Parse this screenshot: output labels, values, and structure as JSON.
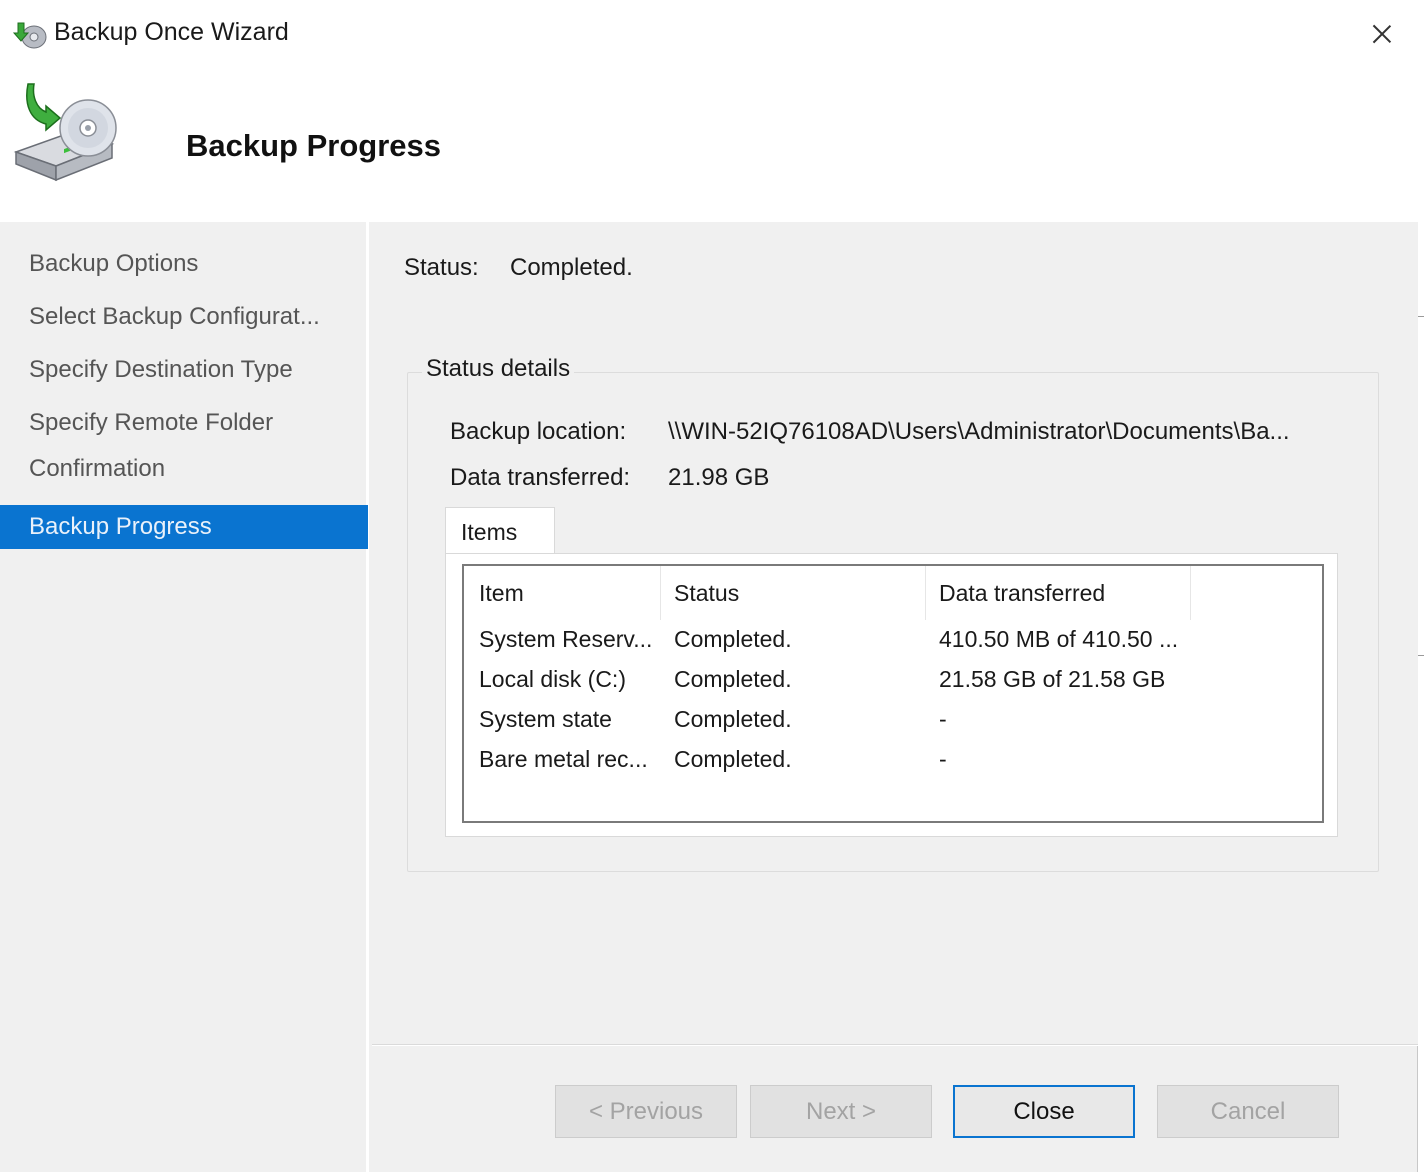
{
  "window": {
    "title": "Backup Once Wizard",
    "close_icon": "close-icon"
  },
  "header": {
    "title": "Backup Progress",
    "icon": "backup-disk-icon"
  },
  "nav": {
    "items": [
      {
        "label": "Backup Options",
        "active": false
      },
      {
        "label": "Select Backup Configurat...",
        "active": false
      },
      {
        "label": "Specify Destination Type",
        "active": false
      },
      {
        "label": "Specify Remote Folder",
        "active": false
      },
      {
        "label": "Confirmation",
        "active": false
      },
      {
        "label": "Backup Progress",
        "active": true
      }
    ]
  },
  "status": {
    "label": "Status:",
    "value": "Completed."
  },
  "details": {
    "legend": "Status details",
    "location_label": "Backup location:",
    "location_value": "\\\\WIN-52IQ76108AD\\Users\\Administrator\\Documents\\Ba...",
    "transferred_label": "Data transferred:",
    "transferred_value": "21.98 GB",
    "tab_label": "Items",
    "columns": [
      "Item",
      "Status",
      "Data transferred"
    ],
    "rows": [
      {
        "item": "System Reserv...",
        "status": "Completed.",
        "transferred": "410.50 MB of 410.50 ..."
      },
      {
        "item": "Local disk (C:)",
        "status": "Completed.",
        "transferred": "21.58 GB of 21.58 GB"
      },
      {
        "item": "System state",
        "status": "Completed.",
        "transferred": "-"
      },
      {
        "item": "Bare metal rec...",
        "status": "Completed.",
        "transferred": "-"
      }
    ]
  },
  "buttons": {
    "previous": "< Previous",
    "next": "Next >",
    "close": "Close",
    "cancel": "Cancel"
  },
  "colors": {
    "accent": "#0a74d0",
    "window_bg": "#f0f0f0"
  }
}
